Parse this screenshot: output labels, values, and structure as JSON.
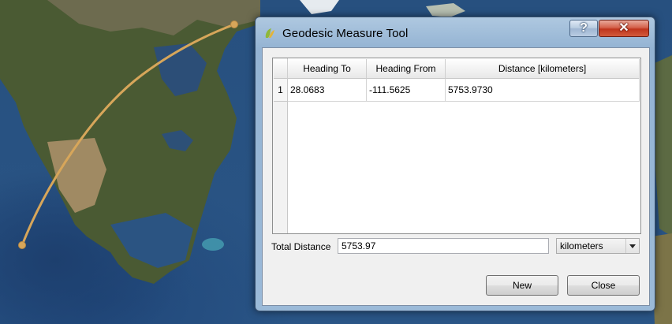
{
  "window": {
    "title": "Geodesic Measure Tool",
    "help_glyph": "?",
    "close_glyph": "✕"
  },
  "table": {
    "columns": [
      "Heading To",
      "Heading From",
      "Distance [kilometers]"
    ],
    "rows": [
      {
        "index": "1",
        "heading_to": "28.0683",
        "heading_from": "-111.5625",
        "distance": "5753.9730"
      }
    ]
  },
  "total": {
    "label": "Total Distance",
    "value": "5753.97",
    "unit_selected": "kilometers"
  },
  "buttons": {
    "new_label": "New",
    "close_label": "Close"
  },
  "map": {
    "measure_line_color": "#d7a65a",
    "water_color": "#2a5586",
    "land_color": "#4b5e35"
  }
}
